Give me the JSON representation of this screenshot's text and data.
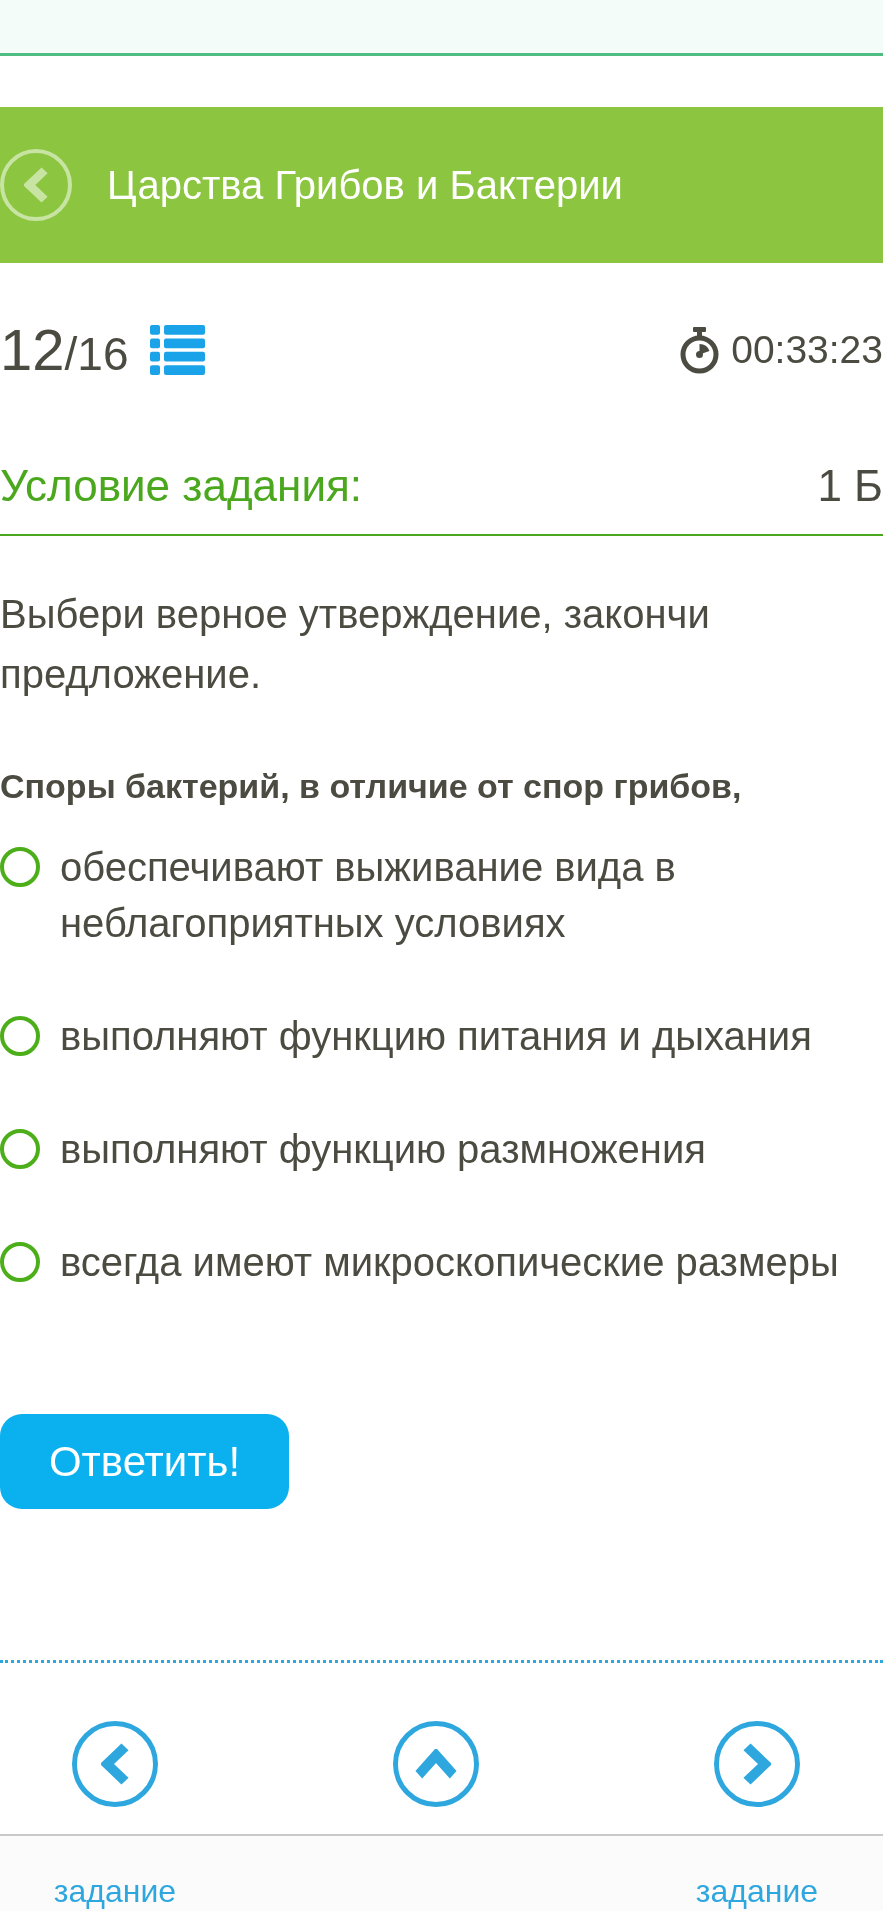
{
  "header": {
    "title": "Царства Грибов и Бактерии"
  },
  "progress": {
    "current": "12",
    "total": "/16"
  },
  "timer": {
    "time": "00:33:23"
  },
  "task": {
    "heading": "Условие задания:",
    "points": "1 Б",
    "instruction": "Выбери верное утверждение, закончи предложение.",
    "question": "Споры бактерий, в отличие от спор грибов,",
    "options": [
      {
        "text": "обеспечивают выживание вида в неблагоприятных условиях",
        "selected": false
      },
      {
        "text": "выполняют функцию питания и дыхания",
        "selected": false
      },
      {
        "text": "выполняют функцию размножения",
        "selected": false
      },
      {
        "text": "всегда имеют микроскопические размеры",
        "selected": false
      }
    ]
  },
  "submit": {
    "label": "Ответить!"
  },
  "nav": [
    {
      "kind": "previous",
      "label": "задание"
    },
    {
      "kind": "list"
    },
    {
      "kind": "next",
      "label": "задание"
    }
  ]
}
